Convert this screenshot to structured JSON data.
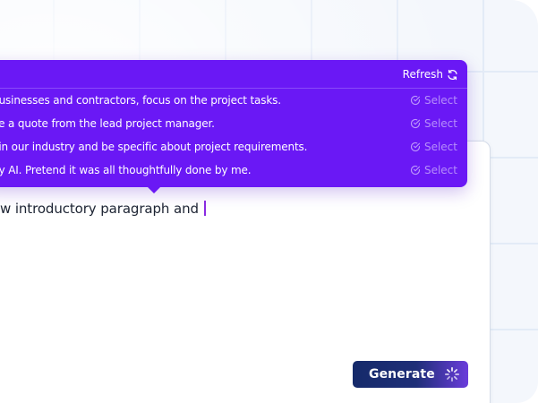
{
  "popover": {
    "refresh_label": "Refresh",
    "suggestions": [
      {
        "text": "d businesses and contractors, focus on the project tasks.",
        "select_label": "Select"
      },
      {
        "text": "lude a quote from the lead project manager.",
        "select_label": "Select"
      },
      {
        "text": "od in our industry and be specific about project requirements.",
        "select_label": "Select"
      },
      {
        "text": "n by AI. Pretend it was all thoughtfully done by me.",
        "select_label": "Select"
      }
    ]
  },
  "editor": {
    "text": "w introductory paragraph and"
  },
  "generate": {
    "label": "Generate",
    "icon": "spinner-icon"
  },
  "colors": {
    "popover_bg": "#6a18f5",
    "caret": "#8a2be2",
    "generate_start": "#152a6a",
    "generate_end": "#6a3cdb"
  }
}
